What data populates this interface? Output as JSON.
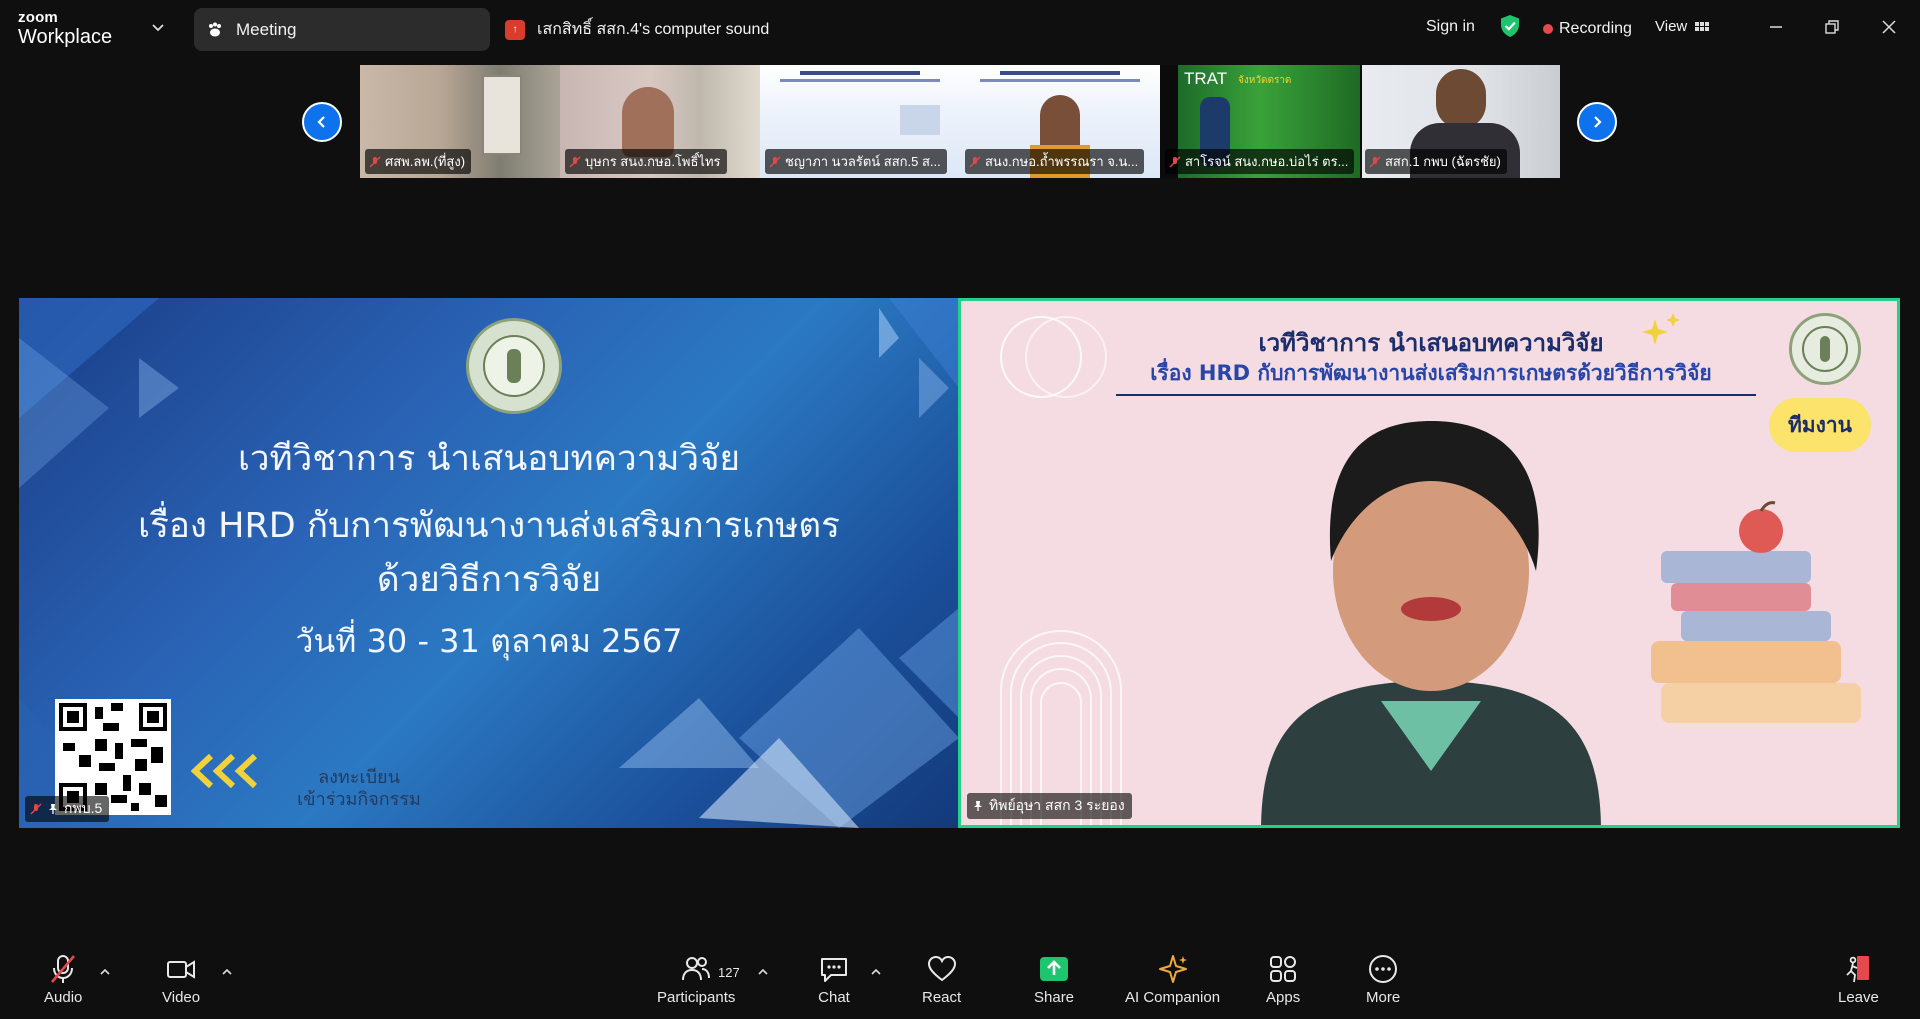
{
  "titlebar": {
    "brand_small": "zoom",
    "brand_large": "Workplace",
    "meeting_tab_label": "Meeting",
    "share_status": "เสกสิทธิ์ สสก.4's computer sound",
    "sign_in": "Sign in",
    "recording": "Recording",
    "view": "View"
  },
  "thumbnails": [
    {
      "name": "ศสพ.ลพ.(ที่สูง)"
    },
    {
      "name": "บุษกร สนง.กษอ.โพธิ์ไทร"
    },
    {
      "name": "ชญาภา นวลรัตน์ สสก.5 ส..."
    },
    {
      "name": "สนง.กษอ.ถ้ำพรรณรา จ.น..."
    },
    {
      "name": "สาโรจน์ สนง.กษอ.บ่อไร่ ตร...",
      "banner": "TRAT",
      "banner_sub": "จังหวัดตราด"
    },
    {
      "name": "สสก.1 กพบ (ฉัตรชัย)"
    }
  ],
  "left_tile": {
    "name": "กพบ.5",
    "slide": {
      "line1": "เวทีวิชาการ  นำเสนอบทความวิจัย",
      "line2": "เรื่อง HRD กับการพัฒนางานส่งเสริมการเกษตร",
      "line3": "ด้วยวิธีการวิจัย",
      "date": "วันที่ 30 - 31 ตุลาคม 2567",
      "register1": "ลงทะเบียน",
      "register2": "เข้าร่วมกิจกรรม"
    }
  },
  "right_tile": {
    "name": "ทิพย์อุษา สสก 3 ระยอง",
    "heading1": "เวทีวิชาการ นำเสนอบทความวิจัย",
    "heading2": "เรื่อง HRD กับการพัฒนางานส่งเสริมการเกษตรด้วยวิธีการวิจัย",
    "badge": "ทีมงาน"
  },
  "toolbar": {
    "audio": "Audio",
    "video": "Video",
    "participants": "Participants",
    "participants_count": "127",
    "chat": "Chat",
    "react": "React",
    "share": "Share",
    "ai_companion": "AI Companion",
    "apps": "Apps",
    "more": "More",
    "leave": "Leave"
  },
  "colors": {
    "accent_blue": "#0e72ed",
    "active_speaker": "#23d18b",
    "share_green": "#1ec46e",
    "recording_red": "#e5484d"
  }
}
